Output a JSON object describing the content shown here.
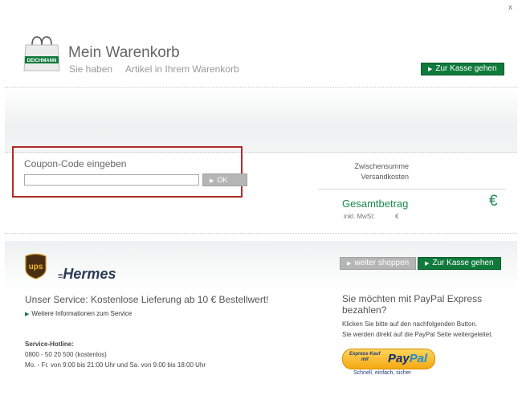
{
  "window": {
    "close_label": "x"
  },
  "header": {
    "brand_logo": "DEICHMANN",
    "title": "Mein Warenkorb",
    "subtitle_part1": "Sie haben",
    "subtitle_part2": "Artikel in Ihrem Warenkorb",
    "checkout_label": "Zur Kasse gehen"
  },
  "coupon": {
    "label": "Coupon-Code eingeben",
    "input_value": "",
    "ok_label": "OK"
  },
  "summary": {
    "subtotal_label": "Zwischensumme",
    "shipping_label": "Versandkosten",
    "total_label": "Gesamtbetrag",
    "total_currency": "€",
    "vat_label": "inkl. MwSt:",
    "vat_currency": "€"
  },
  "actions": {
    "continue_label": "weiter shoppen",
    "checkout_label": "Zur Kasse gehen"
  },
  "shipping": {
    "ups_logo": "ups",
    "hermes_logo": "Hermes",
    "service_text": "Unser Service: Kostenlose Lieferung ab 10 € Bestellwert!",
    "more_info_link": "Weitere Informationen zum Service",
    "hotline_title": "Service-Hotline:",
    "hotline_number": "0800 - 50 20 500 (kostenlos)",
    "hotline_hours": "Mo. - Fr. von 9:00 bis 21:00 Uhr und Sa. von 9:00 bis 18:00 Uhr"
  },
  "paypal": {
    "question": "Sie möchten mit PayPal Express bezahlen?",
    "instruction1": "Klicken Sie bitte auf den nachfolgenden Button.",
    "instruction2": "Sie werden direkt auf die PayPal Seite weitergeleitet.",
    "button_small_line1": "Express-Kauf",
    "button_small_line2": "mit",
    "logo_part1": "Pay",
    "logo_part2": "Pal",
    "tagline": "Schnell, einfach, sicher"
  },
  "colors": {
    "accent_green": "#0f7a3c",
    "total_green": "#1a8a4e",
    "highlight_red": "#b22a2a",
    "paypal_gold": "#f5a914"
  }
}
